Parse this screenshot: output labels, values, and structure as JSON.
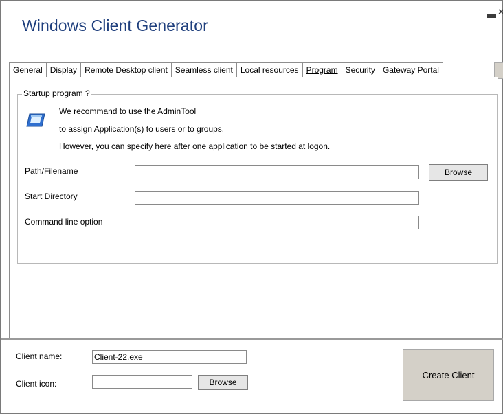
{
  "window": {
    "title": "Windows Client Generator"
  },
  "tabs": [
    {
      "label": "General"
    },
    {
      "label": "Display"
    },
    {
      "label": "Remote Desktop client"
    },
    {
      "label": "Seamless client"
    },
    {
      "label": "Local resources"
    },
    {
      "label": "Program",
      "active": true
    },
    {
      "label": "Security"
    },
    {
      "label": "Gateway Portal"
    }
  ],
  "program": {
    "group_title": "Startup program ?",
    "info": {
      "icon": "window-icon",
      "line1": "We recommand to use the AdminTool",
      "line2": "to assign Application(s) to users or to groups.",
      "line3": "However, you can specify here after one application to be started at logon."
    },
    "path_label": "Path/Filename",
    "path_value": "",
    "browse_label": "Browse",
    "start_dir_label": "Start Directory",
    "start_dir_value": "",
    "cmd_label": "Command line option",
    "cmd_value": ""
  },
  "footer": {
    "client_name_label": "Client name:",
    "client_name_value": "Client-22.exe",
    "client_icon_label": "Client icon:",
    "client_icon_value": "",
    "browse_label": "Browse",
    "create_label": "Create Client"
  }
}
